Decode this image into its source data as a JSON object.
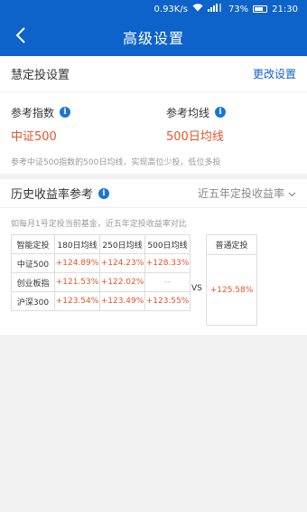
{
  "status_bar": {
    "speed": "0.93K/s",
    "battery": "73%",
    "time": "21:30",
    "accent": "#0d63c9"
  },
  "nav": {
    "title": "高级设置",
    "back_icon": "chevron-left-icon"
  },
  "smart_setting": {
    "heading": "慧定投设置",
    "change_link": "更改设置",
    "index_label": "参考指数",
    "index_value": "中证500",
    "ma_label": "参考均线",
    "ma_value": "500日均线",
    "description": "参考中证500指数的500日均线，实现高位少投，低位多投"
  },
  "history": {
    "heading": "历史收益率参考",
    "dropdown_value": "近五年定投收益率",
    "description": "如每月1号定投当前基金，近五年定投收益率对比",
    "headers": [
      "智能定投",
      "180日均线",
      "250日均线",
      "500日均线"
    ],
    "rows": [
      {
        "name": "中证500",
        "values": [
          "+124.89%",
          "+124.23%",
          "+128.33%"
        ]
      },
      {
        "name": "创业板指",
        "values": [
          "+121.53%",
          "+122.02%",
          "--"
        ]
      },
      {
        "name": "沪深300",
        "values": [
          "+123.54%",
          "+123.49%",
          "+123.55%"
        ]
      }
    ],
    "vs": "VS",
    "normal_header": "普通定投",
    "normal_value": "+125.58%"
  }
}
